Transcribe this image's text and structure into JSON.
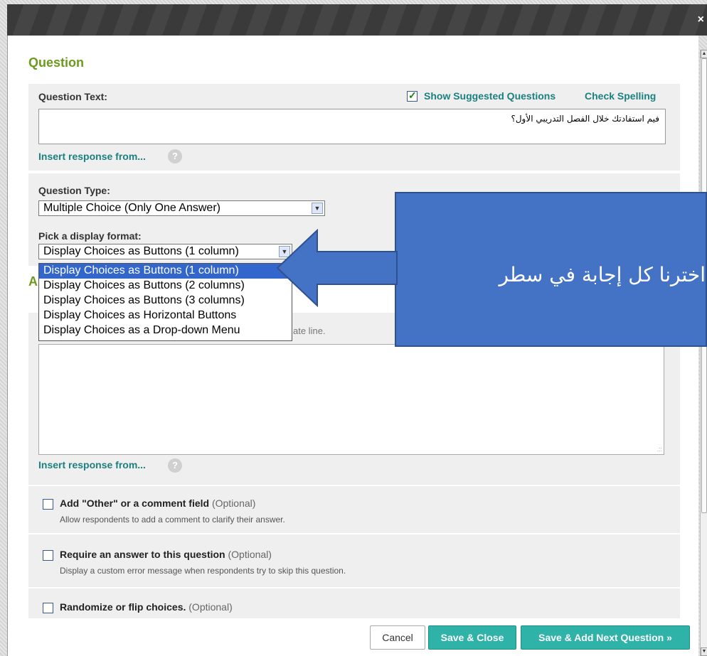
{
  "window": {
    "close_label": "×"
  },
  "question": {
    "section_title": "Question",
    "text_label": "Question Text:",
    "show_suggested_label": "Show Suggested Questions",
    "show_suggested_checked": true,
    "check_spelling_label": "Check Spelling",
    "text_value": "فيم استفادتك خلال الفصل التدريبي الأول؟",
    "insert_response_label": "Insert response from...",
    "help_icon": "?"
  },
  "type": {
    "label": "Question Type:",
    "selected": "Multiple Choice (Only One Answer)",
    "format_label": "Pick a display format:",
    "format_selected": "Display Choices as Buttons (1 column)",
    "format_options": [
      "Display Choices as Buttons (1 column)",
      "Display Choices as Buttons (2 columns)",
      "Display Choices as Buttons (3 columns)",
      "Display Choices as Horizontal Buttons",
      "Display Choices as a Drop-down Menu"
    ]
  },
  "answers": {
    "section_title_partial": "A",
    "hint_partial": "ate line.",
    "insert_response_label": "Insert response from..."
  },
  "options": [
    {
      "title": "Add \"Other\" or a comment field",
      "optional": "(Optional)",
      "description": "Allow respondents to add a comment to clarify their answer.",
      "checked": false
    },
    {
      "title": "Require an answer to this question",
      "optional": "(Optional)",
      "description": "Display a custom error message when respondents try to skip this question.",
      "checked": false
    },
    {
      "title": "Randomize or flip choices.",
      "optional": "(Optional)",
      "description": "",
      "checked": false
    }
  ],
  "footer": {
    "cancel_label": "Cancel",
    "save_close_label": "Save & Close",
    "save_next_label": "Save & Add Next Question »"
  },
  "callout": {
    "text": "اخترنا كل إجابة في سطر"
  },
  "colors": {
    "accent_green": "#6c9a1e",
    "teal": "#2fb3a8",
    "callout_blue": "#4472c4"
  }
}
